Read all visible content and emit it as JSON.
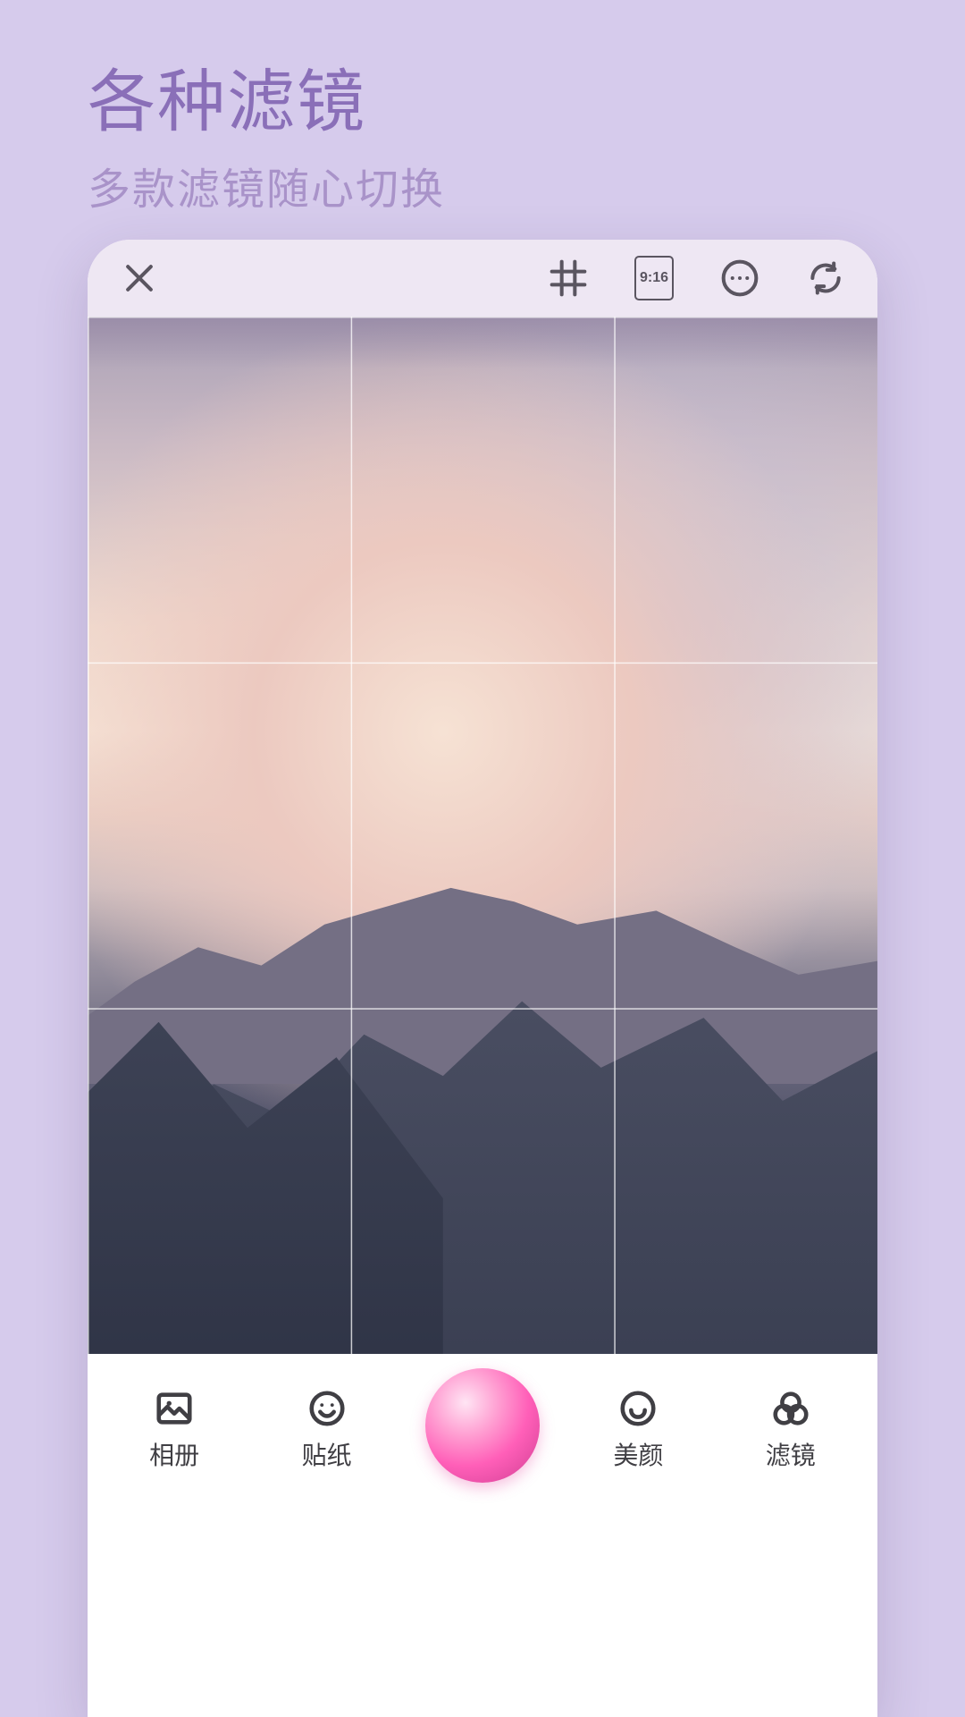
{
  "headline": {
    "title": "各种滤镜",
    "subtitle": "多款滤镜随心切换"
  },
  "topbar": {
    "close": "close",
    "grid": "grid",
    "ratio_label": "9:16",
    "more": "more",
    "rotate": "rotate"
  },
  "bottombar": {
    "album": "相册",
    "sticker": "贴纸",
    "beauty": "美颜",
    "filter": "滤镜"
  }
}
